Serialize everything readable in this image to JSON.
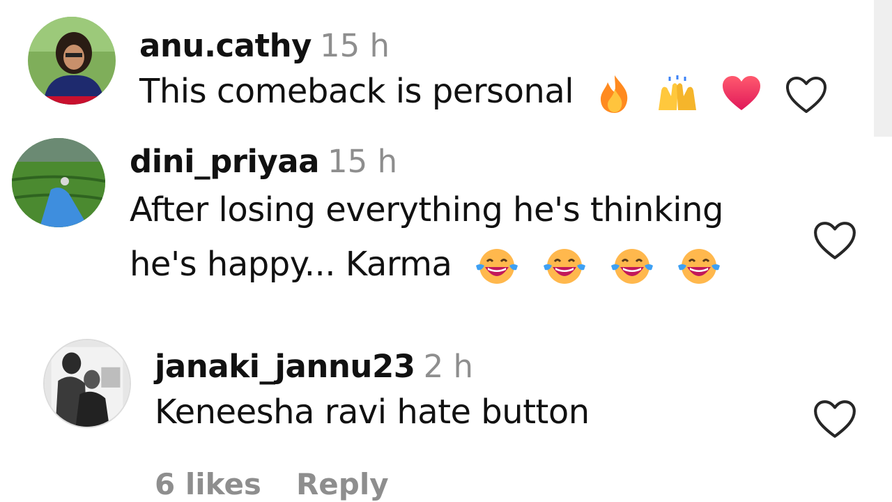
{
  "comments": [
    {
      "username": "anu.cathy",
      "time": "15 h",
      "text": "This comeback is personal",
      "emojis": [
        "fire-emoji",
        "raising-hands-emoji",
        "red-heart-emoji"
      ]
    },
    {
      "username": "dini_priyaa",
      "time": "15 h",
      "text_line1": "After losing everything he's thinking",
      "text_line2": "he's happy... Karma",
      "emojis": [
        "tears-of-joy-emoji",
        "tears-of-joy-emoji",
        "tears-of-joy-emoji",
        "tears-of-joy-emoji"
      ]
    },
    {
      "username": "janaki_jannu23",
      "time": "2 h",
      "text": "Keneesha ravi hate button",
      "likes": "6 likes",
      "reply": "Reply"
    }
  ],
  "icons": {
    "like": "heart-outline-icon"
  },
  "colors": {
    "muted": "#8e8e8e",
    "text": "#111111"
  }
}
